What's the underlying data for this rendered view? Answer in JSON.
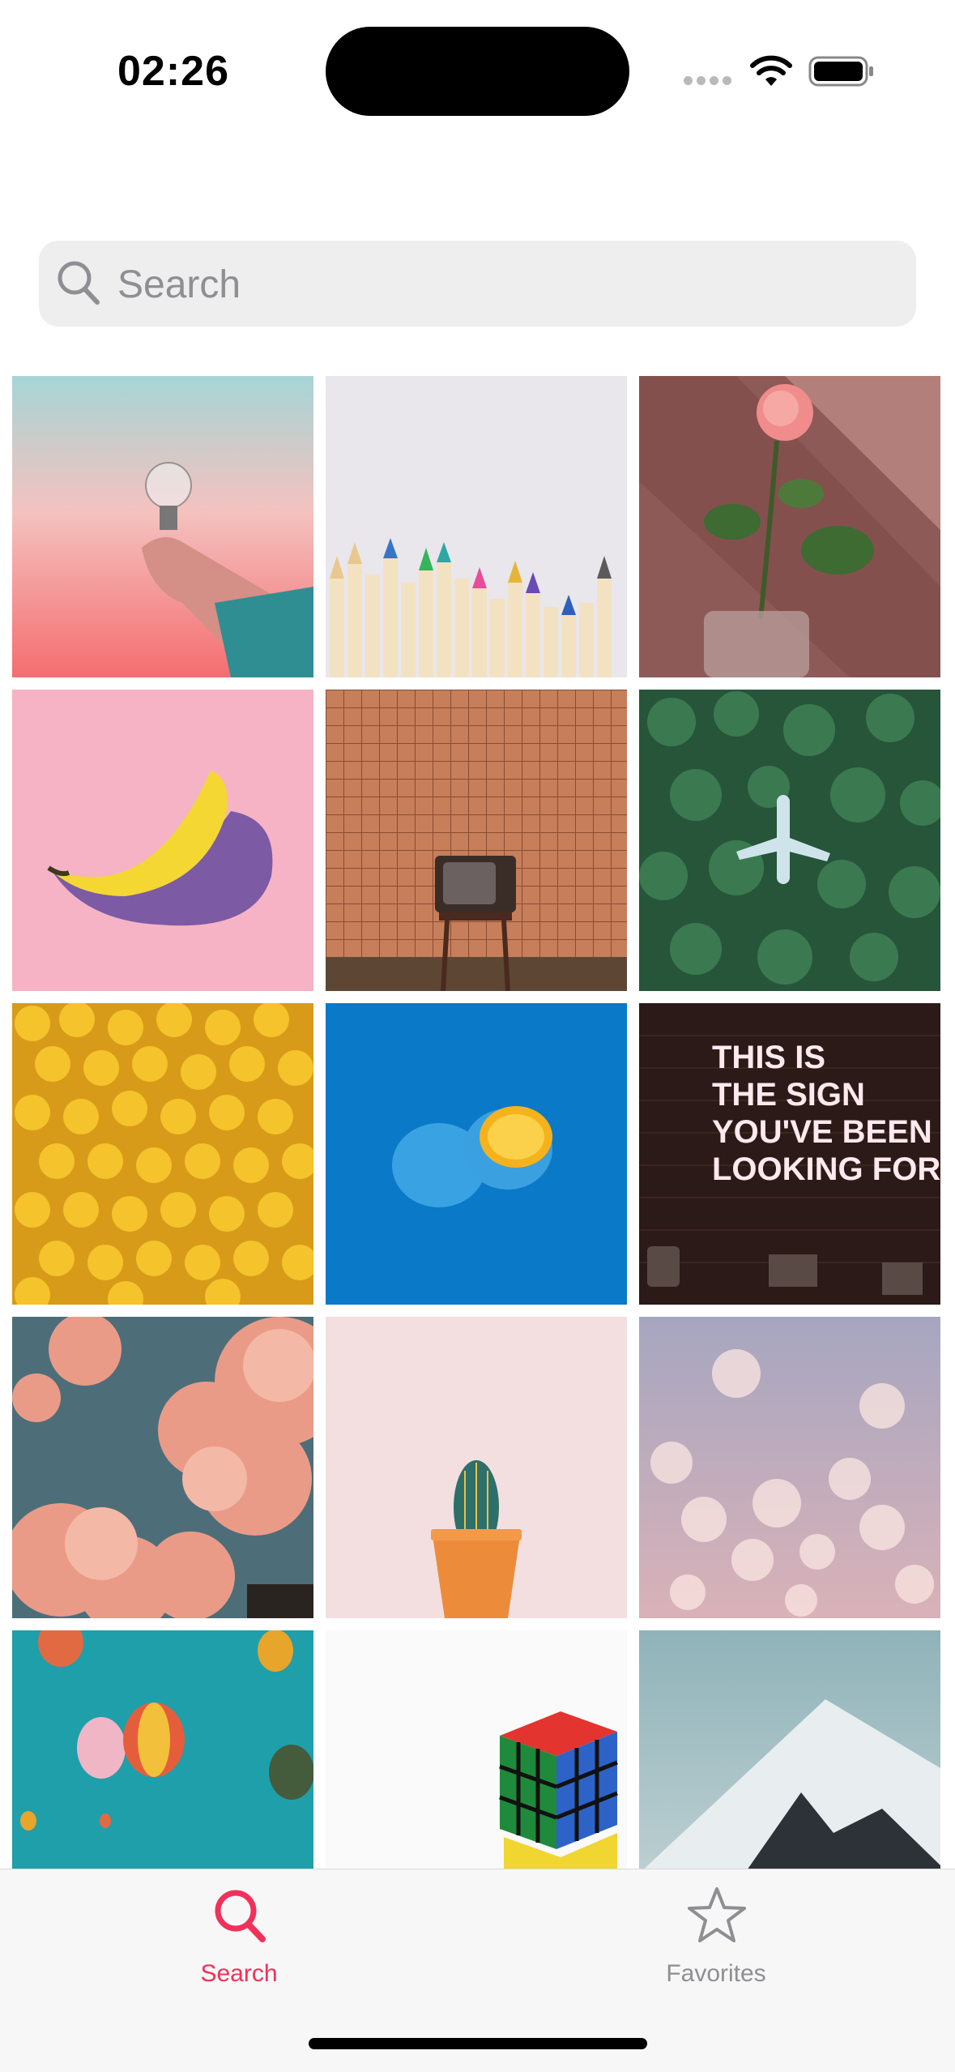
{
  "status_bar": {
    "time": "02:26"
  },
  "search": {
    "placeholder": "Search",
    "value": ""
  },
  "photos": [
    "lightbulb-in-hand",
    "colored-pencils",
    "pink-rose-in-vase",
    "banana-on-pink",
    "retro-tv-on-stool",
    "airplane-over-forest",
    "yellow-figure-heads",
    "blue-painted-orange",
    "neon-sign",
    "pink-clouds",
    "cactus-in-pot",
    "bokeh-lights",
    "hot-air-balloons",
    "rubiks-cube",
    "snowy-mountain"
  ],
  "neon_sign_text": [
    "THIS IS",
    "THE SIGN",
    "YOU'VE BEEN",
    "LOOKING FOR"
  ],
  "tabs": [
    {
      "label": "Search",
      "icon": "search-icon",
      "selected": true
    },
    {
      "label": "Favorites",
      "icon": "star-icon",
      "selected": false
    }
  ],
  "colors": {
    "accent": "#f0315a",
    "inactive": "#8e8e93"
  }
}
